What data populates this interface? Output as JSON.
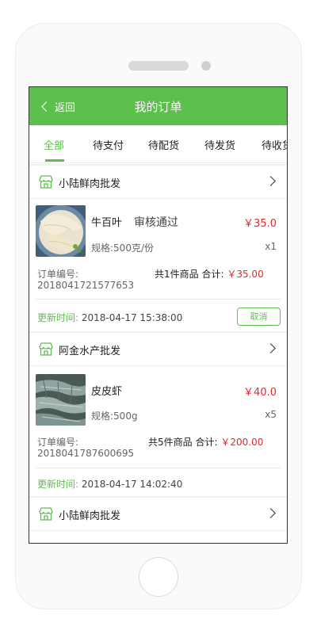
{
  "header": {
    "back_label": "返回",
    "title": "我的订单"
  },
  "tabs": [
    {
      "label": "全部",
      "active": true
    },
    {
      "label": "待支付"
    },
    {
      "label": "待配货"
    },
    {
      "label": "待发货"
    },
    {
      "label": "待收货"
    }
  ],
  "orders": [
    {
      "shop": "小陆鲜肉批发",
      "product": "牛百叶",
      "status": "审核通过",
      "price": "￥35.0",
      "spec": "规格:500克/份",
      "qty": "x1",
      "order_label": "订单编号:",
      "order_no": "2018041721577653",
      "count_text": "共1件商品",
      "total_label": "合计:",
      "total": "￥35.00",
      "update_label": "更新时间:",
      "update_time": "2018-04-17 15:38:00",
      "cancel_label": "取消"
    },
    {
      "shop": "阿金水产批发",
      "product": "皮皮虾",
      "price": "￥40.0",
      "spec": "规格:500g",
      "qty": "x5",
      "order_label": "订单编号:",
      "order_no": "2018041787600695",
      "count_text": "共5件商品",
      "total_label": "合计:",
      "total": "￥200.00",
      "update_label": "更新时间:",
      "update_time": "2018-04-17 14:02:40"
    },
    {
      "shop": "小陆鲜肉批发"
    }
  ],
  "colors": {
    "accent": "#5cc04c",
    "price": "#e0282e"
  }
}
